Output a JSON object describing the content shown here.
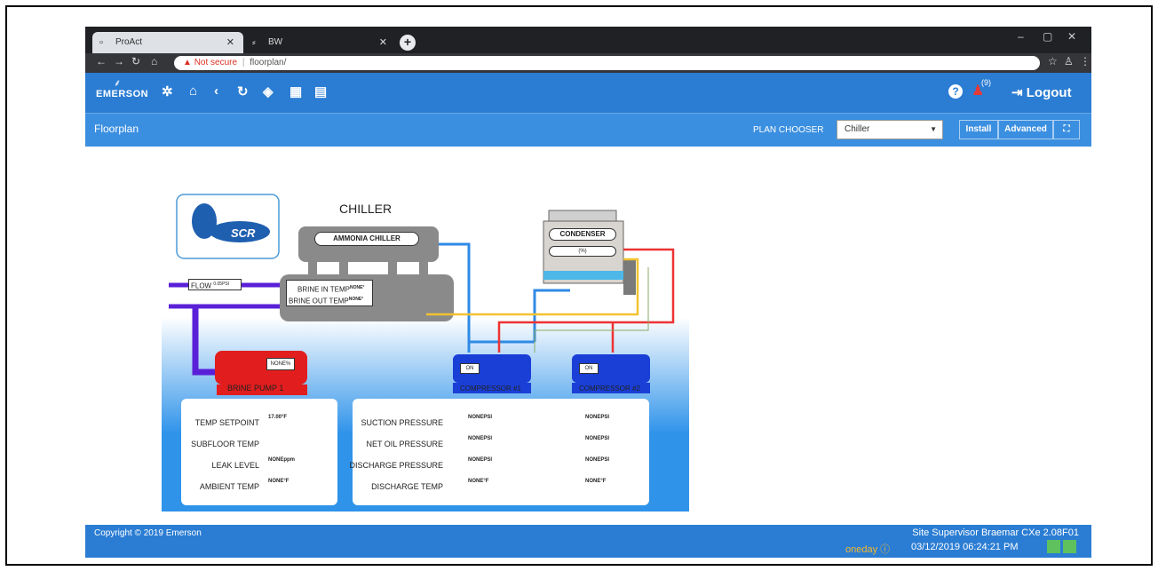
{
  "browser": {
    "tabs": [
      {
        "label": "ProAct"
      },
      {
        "label": "BW"
      }
    ],
    "url": {
      "warning": "Not secure",
      "path": "floorplan/"
    }
  },
  "header": {
    "logo_text": "EMERSON",
    "notification_count": "(9)",
    "logout_label": "Logout"
  },
  "subheader": {
    "title": "Floorplan",
    "plan_chooser_label": "PLAN CHOOSER",
    "plan_selected": "Chiller",
    "install_label": "Install",
    "advanced_label": "Advanced"
  },
  "floorplan": {
    "title": "CHILLER",
    "logo_text": "SCR",
    "ammonia_chiller": "AMMONIA CHILLER",
    "condenser": "CONDENSER",
    "condenser_value": "(%)",
    "flow_label": "FLOW",
    "flow_value": "0.05PSI",
    "brine_in": "BRINE IN TEMP",
    "brine_in_value": "NONE°",
    "brine_out": "BRINE OUT TEMP",
    "brine_out_value": "NONE°",
    "pump_label": "BRINE PUMP 1",
    "pump_value": "NONE%",
    "compressor1_label": "COMPRESSOR #1",
    "compressor1_state": "ON",
    "compressor2_label": "COMPRESSOR #2",
    "compressor2_state": "ON",
    "left_panel": [
      {
        "label": "TEMP SETPOINT",
        "value": "17.00°F"
      },
      {
        "label": "SUBFLOOR TEMP",
        "value": ""
      },
      {
        "label": "LEAK LEVEL",
        "value": "NONEppm"
      },
      {
        "label": "AMBIENT TEMP",
        "value": "NONE°F"
      }
    ],
    "right_panel": [
      {
        "label": "SUCTION PRESSURE",
        "v1": "NONEPSI",
        "v2": "NONEPSI"
      },
      {
        "label": "NET OIL PRESSURE",
        "v1": "NONEPSI",
        "v2": "NONEPSI"
      },
      {
        "label": "DISCHARGE PRESSURE",
        "v1": "NONEPSI",
        "v2": "NONEPSI"
      },
      {
        "label": "DISCHARGE TEMP",
        "v1": "NONE°F",
        "v2": "NONE°F"
      }
    ]
  },
  "footer": {
    "copyright": "Copyright © 2019 Emerson",
    "site": "Site Supervisor Braemar CXe 2.08F01",
    "user": "oneday",
    "datetime": "03/12/2019 06:24:21 PM"
  },
  "colors": {
    "header_blue": "#2b7dd3",
    "pump_red": "#e21d1d",
    "compressor_blue": "#1a3fd6",
    "status_green": "#5ec15e"
  }
}
